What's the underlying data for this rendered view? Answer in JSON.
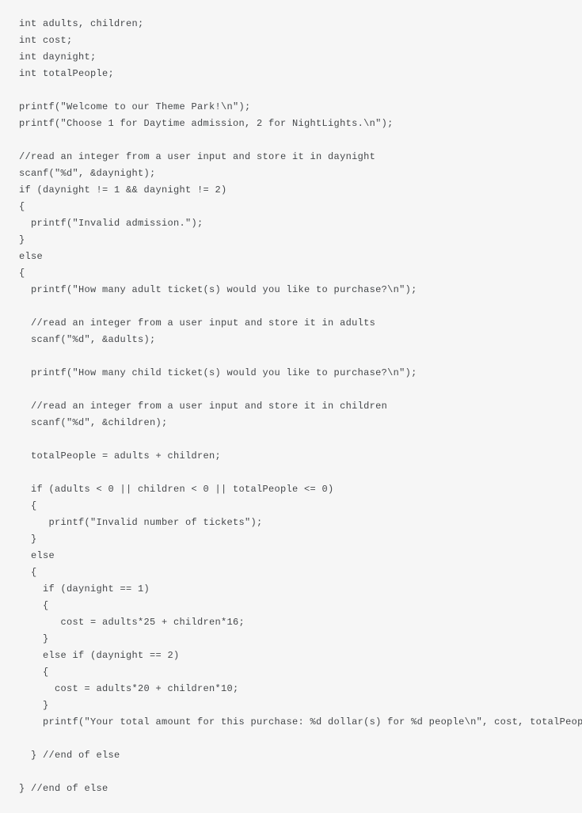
{
  "code": {
    "lines": [
      "int adults, children;",
      "int cost;",
      "int daynight;",
      "int totalPeople;",
      "",
      "printf(\"Welcome to our Theme Park!\\n\");",
      "printf(\"Choose 1 for Daytime admission, 2 for NightLights.\\n\");",
      "",
      "//read an integer from a user input and store it in daynight",
      "scanf(\"%d\", &daynight);",
      "if (daynight != 1 && daynight != 2)",
      "{",
      "  printf(\"Invalid admission.\");",
      "}",
      "else",
      "{",
      "  printf(\"How many adult ticket(s) would you like to purchase?\\n\");",
      "",
      "  //read an integer from a user input and store it in adults",
      "  scanf(\"%d\", &adults);",
      "",
      "  printf(\"How many child ticket(s) would you like to purchase?\\n\");",
      "",
      "  //read an integer from a user input and store it in children",
      "  scanf(\"%d\", &children);",
      "",
      "  totalPeople = adults + children;",
      "",
      "  if (adults < 0 || children < 0 || totalPeople <= 0)",
      "  {",
      "     printf(\"Invalid number of tickets\");",
      "  }",
      "  else",
      "  {",
      "    if (daynight == 1)",
      "    {",
      "       cost = adults*25 + children*16;",
      "    }",
      "    else if (daynight == 2)",
      "    {",
      "      cost = adults*20 + children*10;",
      "    }",
      "    printf(\"Your total amount for this purchase: %d dollar(s) for %d people\\n\", cost, totalPeople);",
      "",
      "  } //end of else",
      "",
      "} //end of else"
    ]
  }
}
